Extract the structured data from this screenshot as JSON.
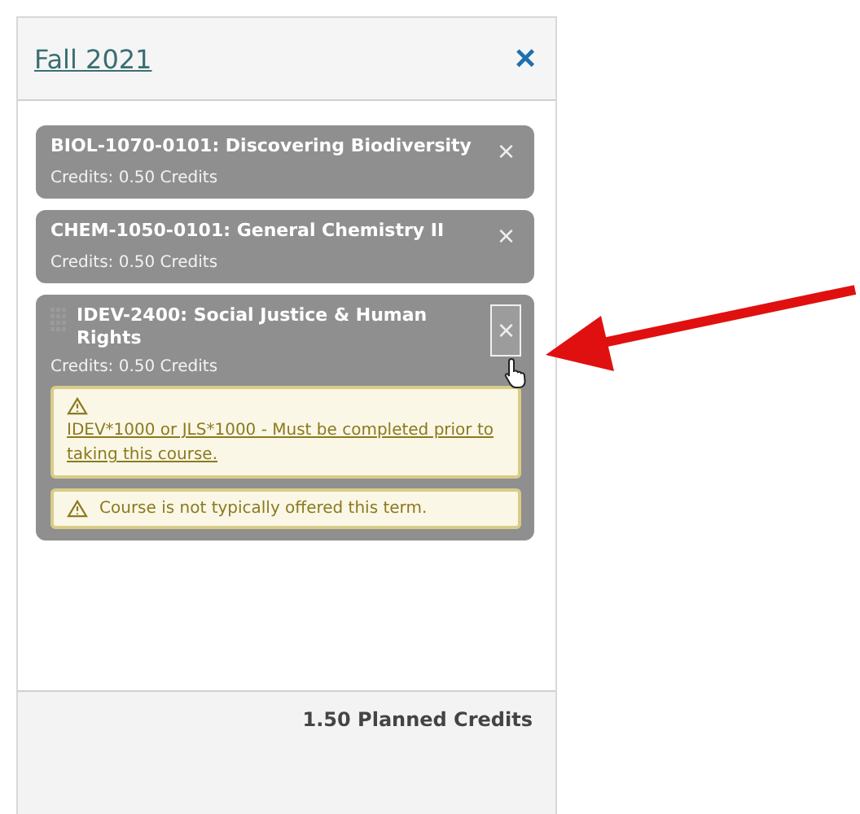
{
  "term": {
    "title": "Fall 2021",
    "close": "×"
  },
  "courses": [
    {
      "title": "BIOL-1070-0101: Discovering Biodiversity",
      "credits": "Credits: 0.50 Credits",
      "remove": "×",
      "hovered": false
    },
    {
      "title": "CHEM-1050-0101: General Chemistry II",
      "credits": "Credits: 0.50 Credits",
      "remove": "×",
      "hovered": false
    },
    {
      "title": "IDEV-2400: Social Justice & Human Rights",
      "credits": "Credits: 0.50 Credits",
      "remove": "×",
      "hovered": true,
      "warnings": [
        {
          "kind": "link",
          "text": "IDEV*1000 or JLS*1000 - Must be completed prior to taking this course."
        },
        {
          "kind": "note",
          "text": "Course is not typically offered this term."
        }
      ]
    }
  ],
  "footer": {
    "total": "1.50 Planned Credits"
  }
}
